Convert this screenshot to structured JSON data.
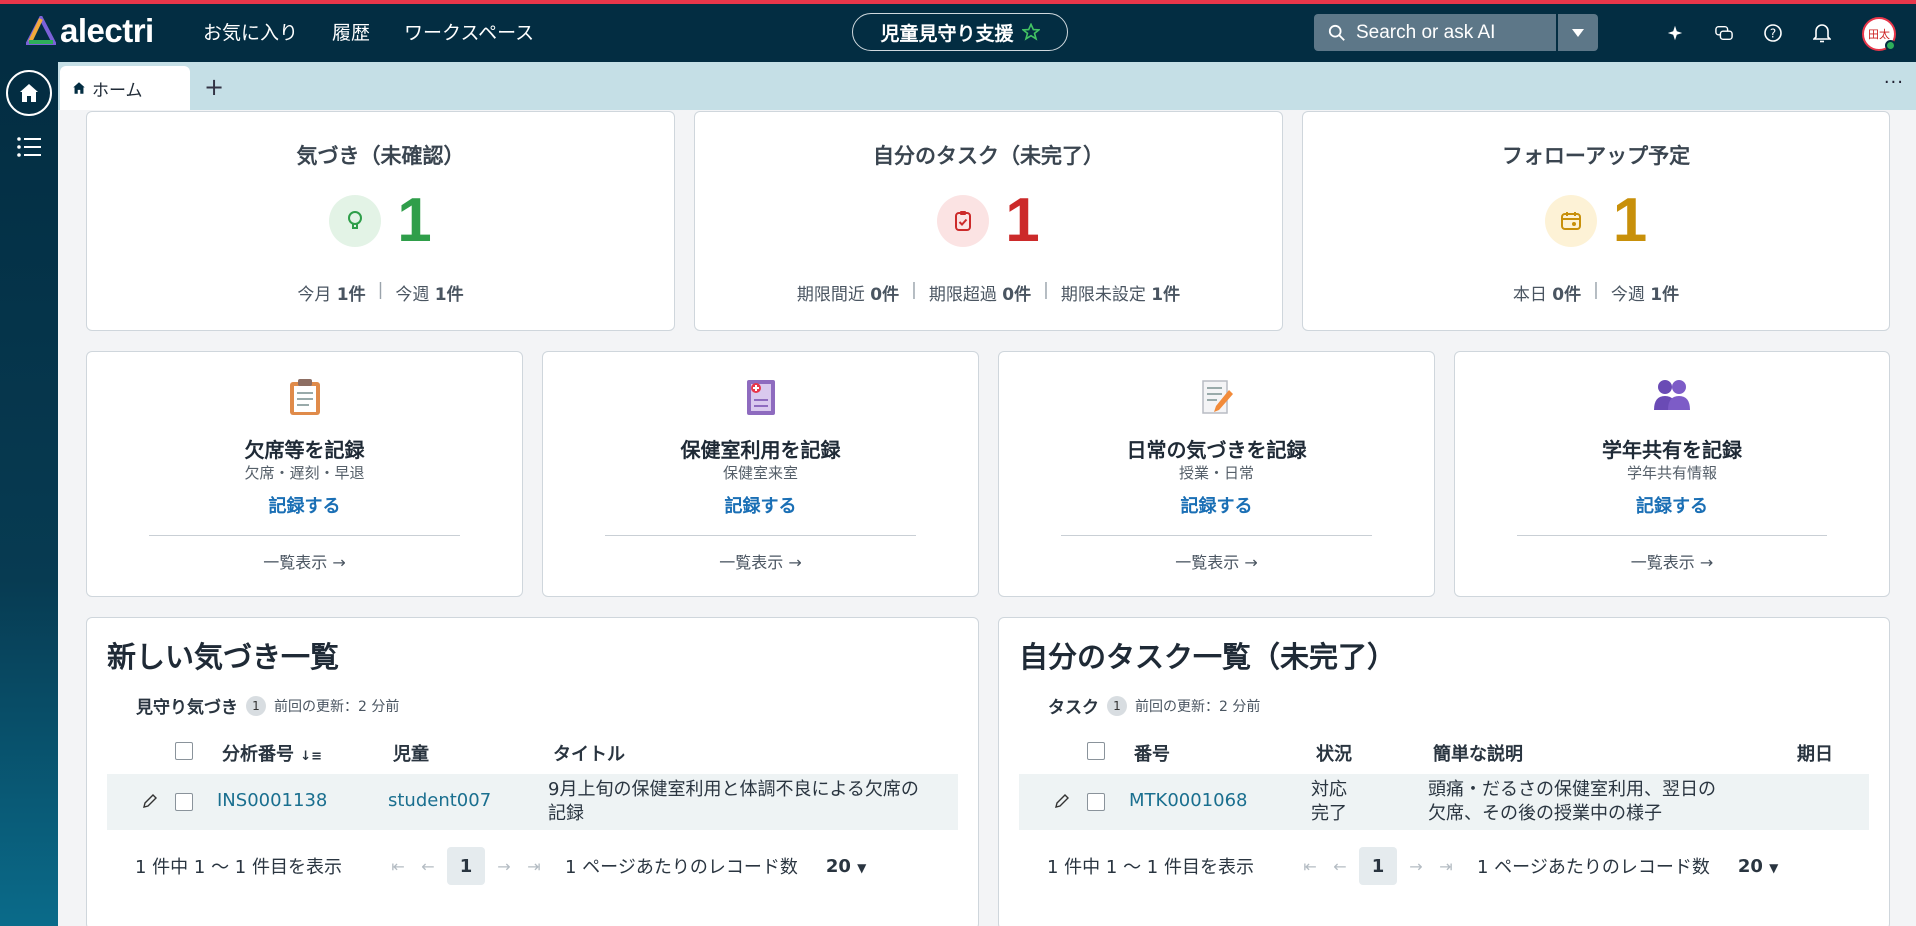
{
  "header": {
    "logo_text": "alectri",
    "nav": [
      "お気に入り",
      "履歴",
      "ワークスペース"
    ],
    "workspace": "児童見守り支援",
    "search_placeholder": "Search or ask AI",
    "accent": "#e8364a",
    "icons": [
      "sparkle-icon",
      "chat-icon",
      "help-icon",
      "bell-icon"
    ],
    "avatar_initials": "田太"
  },
  "tabs": {
    "home_label": "ホーム",
    "add": "+",
    "more": "···"
  },
  "stats": [
    {
      "title": "気づき（未確認）",
      "value": "1",
      "color": "#2f9e4a",
      "bg": "#e3f3e6",
      "icon": "lightbulb-icon",
      "sub": [
        [
          "今月",
          "1件"
        ],
        [
          "今週",
          "1件"
        ]
      ]
    },
    {
      "title": "自分のタスク（未完了）",
      "value": "1",
      "color": "#cc2a2a",
      "bg": "#fbe3e3",
      "icon": "clipboard-check-icon",
      "sub": [
        [
          "期限間近",
          "0件"
        ],
        [
          "期限超過",
          "0件"
        ],
        [
          "期限未設定",
          "1件"
        ]
      ]
    },
    {
      "title": "フォローアップ予定",
      "value": "1",
      "color": "#c8900a",
      "bg": "#fdf2d6",
      "icon": "calendar-icon",
      "sub": [
        [
          "本日",
          "0件"
        ],
        [
          "今週",
          "1件"
        ]
      ]
    }
  ],
  "actions": [
    {
      "title": "欠席等を記録",
      "sub": "欠席・遅刻・早退",
      "link": "記録する",
      "list": "一覧表示 →",
      "icon": "clipboard-icon"
    },
    {
      "title": "保健室利用を記録",
      "sub": "保健室来室",
      "link": "記録する",
      "list": "一覧表示 →",
      "icon": "medical-record-icon"
    },
    {
      "title": "日常の気づきを記録",
      "sub": "授業・日常",
      "link": "記録する",
      "list": "一覧表示 →",
      "icon": "memo-pencil-icon"
    },
    {
      "title": "学年共有を記録",
      "sub": "学年共有情報",
      "link": "記録する",
      "list": "一覧表示 →",
      "icon": "people-icon"
    }
  ],
  "lists": [
    {
      "title": "新しい気づき一覧",
      "label": "見守り気づき",
      "count": "1",
      "updated": "前回の更新：2 分前",
      "headers": [
        "分析番号",
        "児童",
        "タイトル"
      ],
      "row": {
        "number": "INS0001138",
        "col2": "student007",
        "col3": "9月上旬の保健室利用と体調不良による欠席の記録"
      },
      "pager_text": "1 件中 1 〜 1 件目を表示",
      "page": "1",
      "per_page_label": "1 ページあたりのレコード数",
      "per_page": "20"
    },
    {
      "title": "自分のタスク一覧（未完了）",
      "label": "タスク",
      "count": "1",
      "updated": "前回の更新：2 分前",
      "headers": [
        "番号",
        "状況",
        "簡単な説明",
        "期日"
      ],
      "row": {
        "number": "MTK0001068",
        "col2": "対応完了",
        "col3": "頭痛・だるさの保健室利用、翌日の欠席、その後の授業中の様子"
      },
      "pager_text": "1 件中 1 〜 1 件目を表示",
      "page": "1",
      "per_page_label": "1 ページあたりのレコード数",
      "per_page": "20"
    }
  ]
}
